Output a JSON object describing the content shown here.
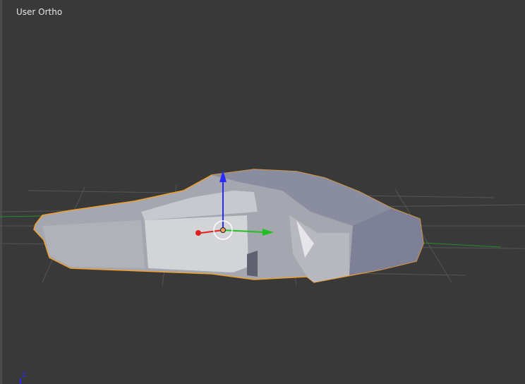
{
  "viewport": {
    "view_label": "User Ortho",
    "axis_indicator_label": "Z",
    "colors": {
      "background": "#393939",
      "selection_outline": "#f0a030",
      "x_axis": "#e02020",
      "y_axis": "#20c020",
      "z_axis": "#2a2aff",
      "mesh": "#a9abb5"
    },
    "selected_object_icon": "car-mesh",
    "gizmo_icon": "transform-manipulator"
  }
}
